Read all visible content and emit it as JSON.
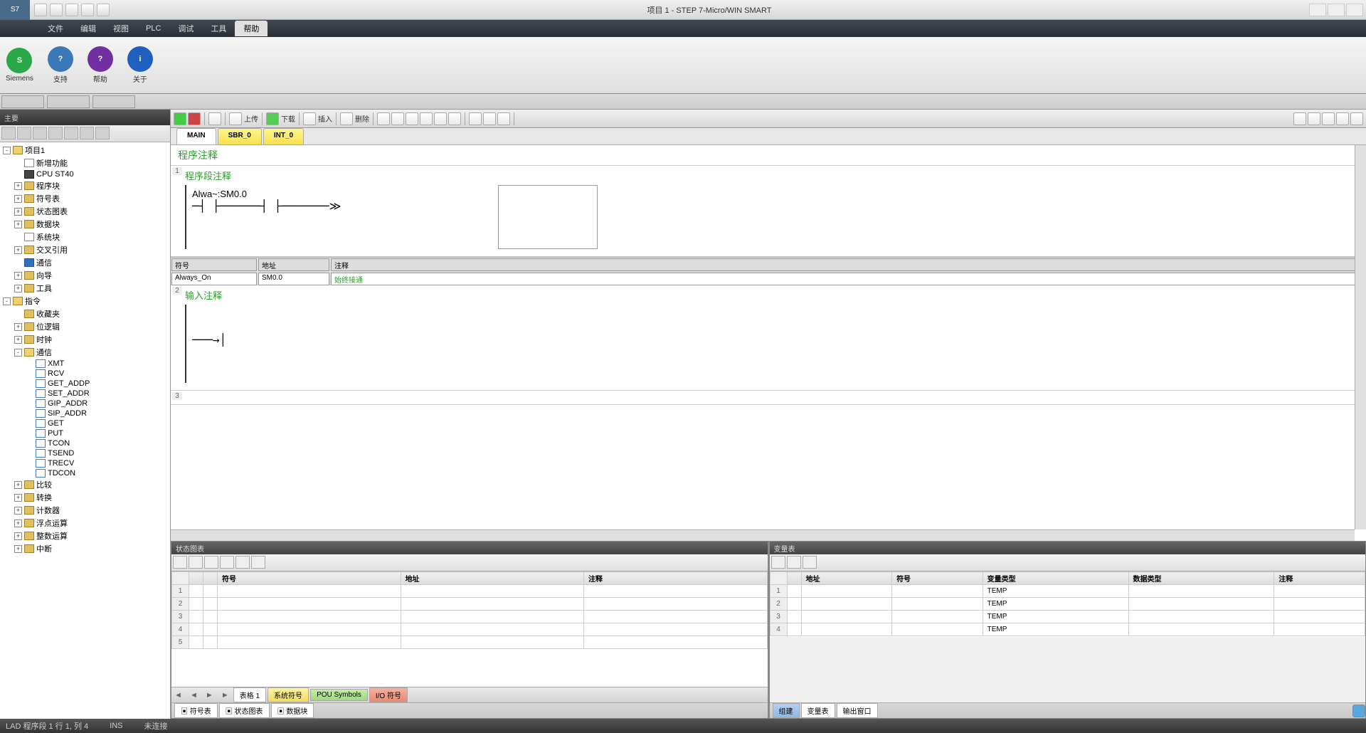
{
  "app": {
    "title": "项目 1 - STEP 7-Micro/WIN SMART"
  },
  "menus": [
    "文件",
    "编辑",
    "视图",
    "PLC",
    "调试",
    "工具",
    "帮助"
  ],
  "active_menu": 6,
  "ribbon": [
    {
      "label": "Siemens",
      "color": "#2aa84a",
      "glyph": "S"
    },
    {
      "label": "支持",
      "color": "#3a78b8",
      "glyph": "?"
    },
    {
      "label": "帮助",
      "color": "#7030a0",
      "glyph": "?"
    },
    {
      "label": "关于",
      "color": "#2060c0",
      "glyph": "i"
    }
  ],
  "left_header": "主要",
  "tree": [
    {
      "lvl": 0,
      "exp": "-",
      "ico": "folder-open",
      "label": "项目1"
    },
    {
      "lvl": 1,
      "exp": "",
      "ico": "page",
      "label": "新增功能"
    },
    {
      "lvl": 1,
      "exp": "",
      "ico": "cpu",
      "label": "CPU ST40"
    },
    {
      "lvl": 1,
      "exp": "+",
      "ico": "folder",
      "label": "程序块"
    },
    {
      "lvl": 1,
      "exp": "+",
      "ico": "folder",
      "label": "符号表"
    },
    {
      "lvl": 1,
      "exp": "+",
      "ico": "folder",
      "label": "状态图表"
    },
    {
      "lvl": 1,
      "exp": "+",
      "ico": "folder",
      "label": "数据块"
    },
    {
      "lvl": 1,
      "exp": "",
      "ico": "page",
      "label": "系统块"
    },
    {
      "lvl": 1,
      "exp": "+",
      "ico": "folder",
      "label": "交叉引用"
    },
    {
      "lvl": 1,
      "exp": "",
      "ico": "blue",
      "label": "通信"
    },
    {
      "lvl": 1,
      "exp": "+",
      "ico": "folder",
      "label": "向导"
    },
    {
      "lvl": 1,
      "exp": "+",
      "ico": "folder",
      "label": "工具"
    },
    {
      "lvl": 0,
      "exp": "-",
      "ico": "folder-open",
      "label": "指令"
    },
    {
      "lvl": 1,
      "exp": "",
      "ico": "folder",
      "label": "收藏夹"
    },
    {
      "lvl": 1,
      "exp": "+",
      "ico": "folder",
      "label": "位逻辑"
    },
    {
      "lvl": 1,
      "exp": "+",
      "ico": "folder",
      "label": "时钟"
    },
    {
      "lvl": 1,
      "exp": "-",
      "ico": "folder-open",
      "label": "通信"
    },
    {
      "lvl": 2,
      "exp": "",
      "ico": "cmd",
      "label": "XMT"
    },
    {
      "lvl": 2,
      "exp": "",
      "ico": "cmd",
      "label": "RCV"
    },
    {
      "lvl": 2,
      "exp": "",
      "ico": "cmd",
      "label": "GET_ADDP"
    },
    {
      "lvl": 2,
      "exp": "",
      "ico": "cmd",
      "label": "SET_ADDR"
    },
    {
      "lvl": 2,
      "exp": "",
      "ico": "cmd",
      "label": "GIP_ADDR"
    },
    {
      "lvl": 2,
      "exp": "",
      "ico": "cmd",
      "label": "SIP_ADDR"
    },
    {
      "lvl": 2,
      "exp": "",
      "ico": "cmd",
      "label": "GET"
    },
    {
      "lvl": 2,
      "exp": "",
      "ico": "cmd",
      "label": "PUT"
    },
    {
      "lvl": 2,
      "exp": "",
      "ico": "cmd",
      "label": "TCON"
    },
    {
      "lvl": 2,
      "exp": "",
      "ico": "cmd",
      "label": "TSEND"
    },
    {
      "lvl": 2,
      "exp": "",
      "ico": "cmd",
      "label": "TRECV"
    },
    {
      "lvl": 2,
      "exp": "",
      "ico": "cmd",
      "label": "TDCON"
    },
    {
      "lvl": 1,
      "exp": "+",
      "ico": "folder",
      "label": "比较"
    },
    {
      "lvl": 1,
      "exp": "+",
      "ico": "folder",
      "label": "转换"
    },
    {
      "lvl": 1,
      "exp": "+",
      "ico": "folder",
      "label": "计数器"
    },
    {
      "lvl": 1,
      "exp": "+",
      "ico": "folder",
      "label": "浮点运算"
    },
    {
      "lvl": 1,
      "exp": "+",
      "ico": "folder",
      "label": "整数运算"
    },
    {
      "lvl": 1,
      "exp": "+",
      "ico": "folder",
      "label": "中断"
    }
  ],
  "editor_tabs": [
    "MAIN",
    "SBR_0",
    "INT_0"
  ],
  "editor_active_tab": 0,
  "toolbar_actions": {
    "upload": "上传",
    "download": "下载",
    "insert": "插入",
    "delete": "删除"
  },
  "program_header": "程序注释",
  "network1": {
    "title": "程序段注释",
    "contact_label": "Alwa~:SM0.0"
  },
  "network2": {
    "title": "输入注释"
  },
  "formula": {
    "headers": [
      "符号",
      "地址",
      "注释"
    ],
    "row": [
      "Always_On",
      "SM0.0",
      "始终接通"
    ]
  },
  "panel_left": {
    "title": "状态图表",
    "headers": [
      "符号",
      "地址",
      "注释"
    ],
    "bottom_tabs_nav": "◄ ◄ ► ►",
    "bottom_tabs": [
      "表格 1",
      "系统符号",
      "POU Symbols",
      "I/O 符号"
    ]
  },
  "panel_right": {
    "title": "变量表",
    "headers": [
      "地址",
      "符号",
      "变量类型",
      "数据类型",
      "注释"
    ],
    "rows": [
      [
        "",
        "",
        "TEMP",
        "",
        ""
      ],
      [
        "",
        "",
        "TEMP",
        "",
        ""
      ],
      [
        "",
        "",
        "TEMP",
        "",
        ""
      ],
      [
        "",
        "",
        "TEMP",
        "",
        ""
      ]
    ],
    "bottom_tabs": [
      "组建",
      "变量表",
      "输出窗口"
    ]
  },
  "status": {
    "left": "LAD 程序段 1   行 1, 列 4",
    "ins": "INS",
    "conn": "未连接"
  }
}
